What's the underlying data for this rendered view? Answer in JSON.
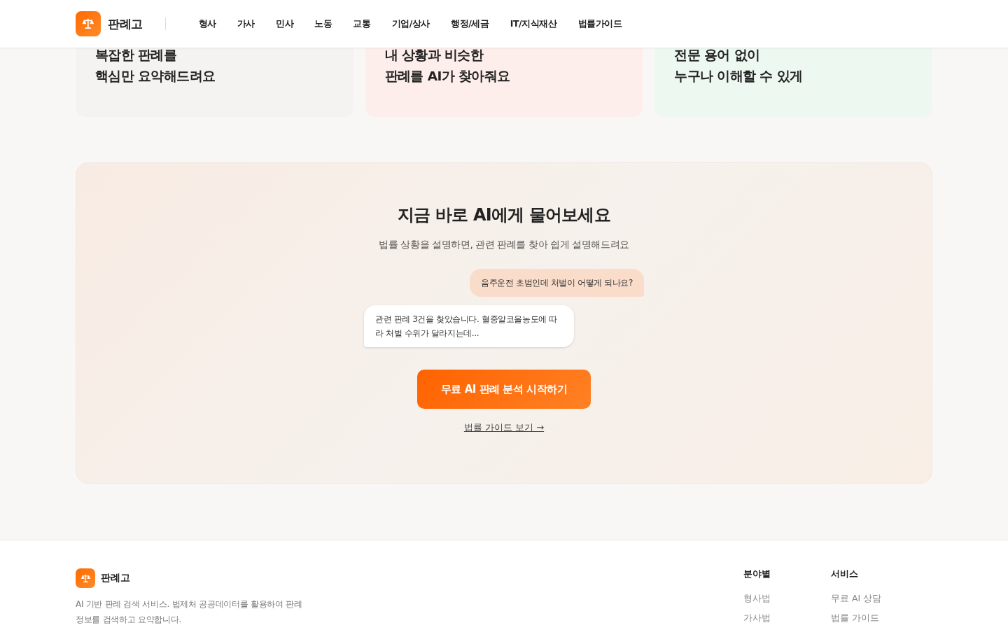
{
  "header": {
    "brand": "판례고",
    "nav": [
      {
        "label": "형사"
      },
      {
        "label": "가사"
      },
      {
        "label": "민사"
      },
      {
        "label": "노동"
      },
      {
        "label": "교통"
      },
      {
        "label": "기업/상사"
      },
      {
        "label": "행정/세금"
      },
      {
        "label": "IT/지식재산"
      },
      {
        "label": "법률가이드"
      }
    ]
  },
  "features": [
    {
      "heading": [
        "복잡한 판례를",
        "핵심만 요약해드려요"
      ],
      "color": "#f4f3f1"
    },
    {
      "heading": [
        "내 상황과 비슷한",
        "판례를 AI가 찾아줘요"
      ],
      "color": "#fdeeeb"
    },
    {
      "heading": [
        "전문 용어 없이",
        "누구나 이해할 수 있게"
      ],
      "color": "#edf8f0"
    }
  ],
  "cta": {
    "title": "지금 바로 AI에게 물어보세요",
    "subtitle": "법률 상황을 설명하면, 관련 판례를 찾아 쉽게 설명해드려요",
    "chat": [
      {
        "kind": "user",
        "text": "음주운전 초범인데 처벌이 어떻게 되나요?"
      },
      {
        "kind": "ai",
        "text": "관련 판례 3건을 찾았습니다. 혈중알코올농도에 따라 처벌 수위가 달라지는데..."
      }
    ],
    "button": "무료 AI 판례 분석 시작하기",
    "link": "법률 가이드 보기 →"
  },
  "footer": {
    "brand": "판례고",
    "description": "AI 기반 판례 검색 서비스. 법제처 공공데이터를 활용하여 판례 정보를 검색하고 요약합니다.",
    "columns": [
      {
        "title": "분야별",
        "links": [
          "형사법",
          "가사법"
        ]
      },
      {
        "title": "서비스",
        "links": [
          "무료 AI 상담",
          "법률 가이드"
        ]
      }
    ]
  }
}
